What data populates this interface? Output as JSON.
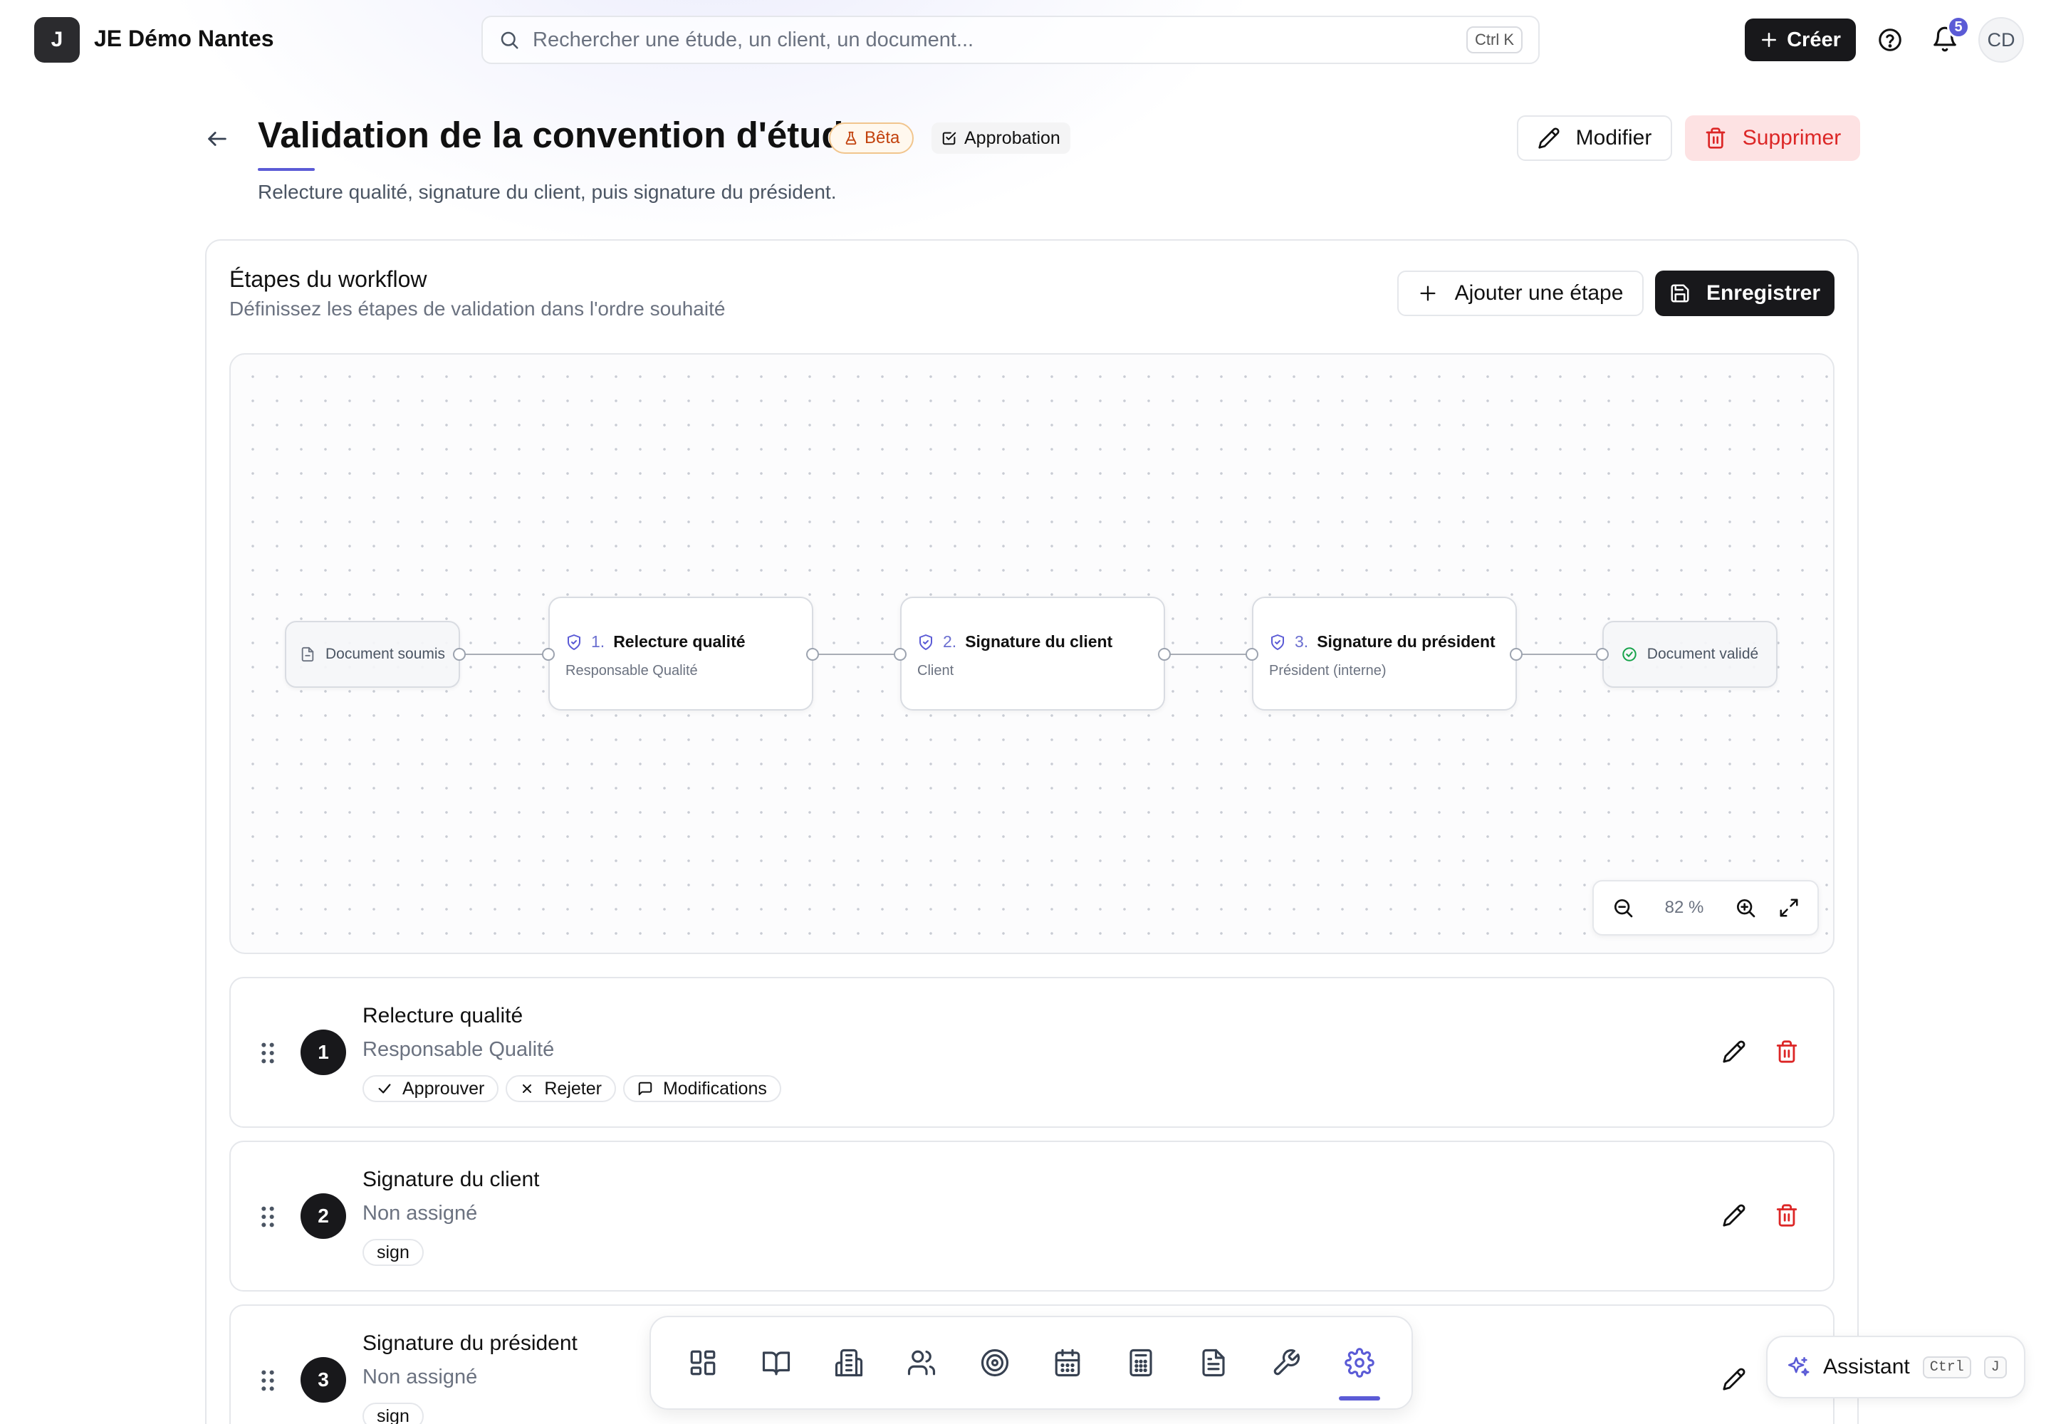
{
  "app": {
    "logo_letter": "J",
    "name": "JE Démo Nantes"
  },
  "search": {
    "placeholder": "Rechercher une étude, un client, un document...",
    "shortcut": "Ctrl K"
  },
  "topbar": {
    "create_label": "Créer",
    "notifications_count": "5",
    "avatar_initials": "CD"
  },
  "header": {
    "title": "Validation de la convention d'étude",
    "beta_label": "Bêta",
    "type_label": "Approbation",
    "subtitle": "Relecture qualité, signature du client, puis signature du président.",
    "edit_label": "Modifier",
    "delete_label": "Supprimer"
  },
  "workflow": {
    "title": "Étapes du workflow",
    "subtitle": "Définissez les étapes de validation dans l'ordre souhaité",
    "add_step_label": "Ajouter une étape",
    "save_label": "Enregistrer"
  },
  "canvas": {
    "start_label": "Document soumis",
    "end_label": "Document validé",
    "nodes": [
      {
        "num": "1.",
        "name": "Relecture qualité",
        "role": "Responsable Qualité"
      },
      {
        "num": "2.",
        "name": "Signature du client",
        "role": "Client"
      },
      {
        "num": "3.",
        "name": "Signature du président",
        "role": "Président (interne)"
      }
    ],
    "zoom": "82 %"
  },
  "steps": [
    {
      "num": "1",
      "name": "Relecture qualité",
      "role": "Responsable Qualité",
      "chips": [
        "Approuver",
        "Rejeter",
        "Modifications"
      ]
    },
    {
      "num": "2",
      "name": "Signature du client",
      "role": "Non assigné",
      "chips": [
        "sign"
      ]
    },
    {
      "num": "3",
      "name": "Signature du président",
      "role": "Non assigné",
      "chips": [
        "sign"
      ]
    }
  ],
  "dock": {
    "items": [
      "dashboard-icon",
      "book-icon",
      "building-icon",
      "users-icon",
      "target-icon",
      "calendar-icon",
      "calculator-icon",
      "document-icon",
      "wrench-icon",
      "settings-icon"
    ],
    "active": "settings-icon"
  },
  "assistant": {
    "label": "Assistant",
    "key1": "Ctrl",
    "key2": "J"
  },
  "colors": {
    "accent": "#5b5bd6",
    "danger": "#dc2626",
    "dark": "#18181b",
    "beta": "#c2410c"
  }
}
